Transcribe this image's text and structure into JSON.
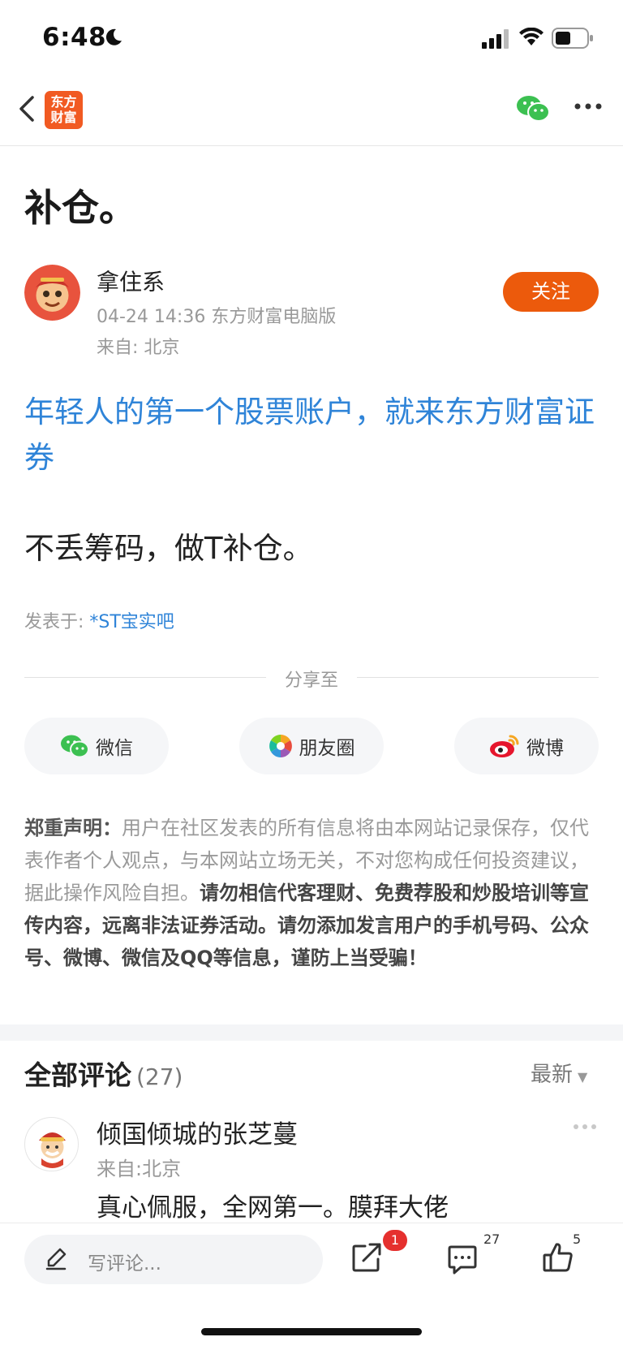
{
  "status_bar": {
    "time": "6:48"
  },
  "nav": {
    "logo_line1": "东方",
    "logo_line2": "财富"
  },
  "post": {
    "title": "补仓。",
    "author": "拿住系",
    "meta": "04-24 14:36 东方财富电脑版",
    "location": "来自: 北京",
    "follow_label": "关注",
    "promo_link": "年轻人的第一个股票账户，就来东方财富证券",
    "body": "不丢筹码，做T补仓。",
    "posted_in_label": "发表于: ",
    "posted_in_bar": "*ST宝实吧"
  },
  "share": {
    "label": "分享至",
    "wechat": "微信",
    "moments": "朋友圈",
    "weibo": "微博"
  },
  "disclaimer": {
    "label": "郑重声明：",
    "normal": "用户在社区发表的所有信息将由本网站记录保存，仅代表作者个人观点，与本网站立场无关，不对您构成任何投资建议，据此操作风险自担。",
    "strong": "请勿相信代客理财、免费荐股和炒股培训等宣传内容，远离非法证券活动。请勿添加发言用户的手机号码、公众号、微博、微信及QQ等信息，谨防上当受骗！"
  },
  "comments": {
    "header": "全部评论",
    "count": "(27)",
    "sort": "最新",
    "items": [
      {
        "name": "倾国倾城的张芝蔓",
        "location": "来自:北京",
        "text": "真心佩服，全网第一。膜拜大佬"
      }
    ]
  },
  "toolbar": {
    "placeholder": "写评论...",
    "share_badge": "1",
    "comment_count": "27",
    "like_count": "5"
  },
  "colors": {
    "accent": "#ec5a0c",
    "link": "#2f84d8",
    "badge": "#e5302e"
  }
}
